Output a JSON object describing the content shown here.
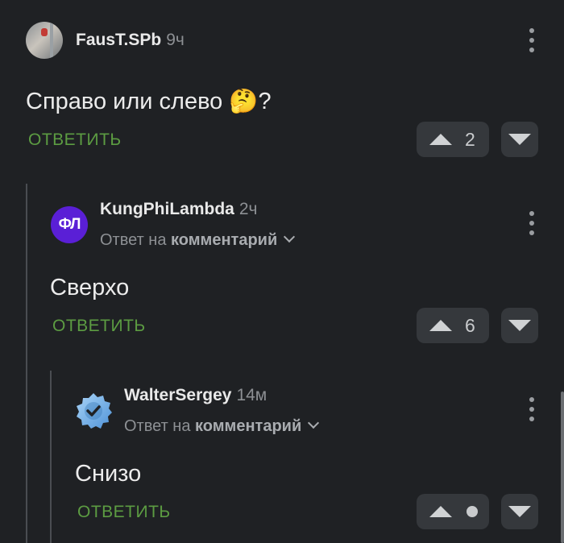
{
  "comments": [
    {
      "author": "FausT.SPb",
      "time": "9ч",
      "text": "Справо или слево",
      "emoji": "🤔",
      "text_suffix": "?",
      "reply_label": "ОТВЕТИТЬ",
      "score": "2"
    },
    {
      "author": "KungPhiLambda",
      "time": "2ч",
      "avatar_letters": "ФЛ",
      "reply_to_prefix": "Ответ на",
      "reply_to_target": "комментарий",
      "text": "Сверхо",
      "reply_label": "ОТВЕТИТЬ",
      "score": "6"
    },
    {
      "author": "WalterSergey",
      "time": "14м",
      "reply_to_prefix": "Ответ на",
      "reply_to_target": "комментарий",
      "text": "Снизо",
      "reply_label": "ОТВЕТИТЬ",
      "score": ""
    }
  ],
  "colors": {
    "background": "#1f2124",
    "reply_link": "#5c9c42",
    "vote_button": "#35383c",
    "avatar_letters_bg": "#5a1fd6",
    "verified_badge": "#6fb0ea"
  },
  "icons": [
    "more-vertical-icon",
    "upvote-arrow-icon",
    "downvote-arrow-icon",
    "chevron-down-icon",
    "verified-badge-icon"
  ]
}
